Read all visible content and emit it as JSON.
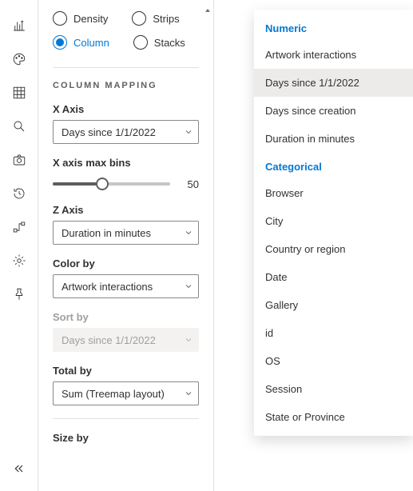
{
  "chartTypes": {
    "density": "Density",
    "strips": "Strips",
    "column": "Column",
    "stacks": "Stacks",
    "selected": "column"
  },
  "sectionTitle": "COLUMN MAPPING",
  "xAxis": {
    "label": "X Axis",
    "value": "Days since 1/1/2022"
  },
  "maxBins": {
    "label": "X axis max bins",
    "value": "50"
  },
  "zAxis": {
    "label": "Z Axis",
    "value": "Duration in minutes"
  },
  "colorBy": {
    "label": "Color by",
    "value": "Artwork interactions"
  },
  "sortBy": {
    "label": "Sort by",
    "value": "Days since 1/1/2022"
  },
  "totalBy": {
    "label": "Total by",
    "value": "Sum (Treemap layout)"
  },
  "sizeBy": {
    "label": "Size by"
  },
  "dropdown": {
    "numericHeader": "Numeric",
    "numeric": [
      "Artwork interactions",
      "Days since 1/1/2022",
      "Days since creation",
      "Duration in minutes"
    ],
    "categoricalHeader": "Categorical",
    "categorical": [
      "Browser",
      "City",
      "Country or region",
      "Date",
      "Gallery",
      "id",
      "OS",
      "Session",
      "State or Province"
    ],
    "highlighted": "Days since 1/1/2022"
  }
}
